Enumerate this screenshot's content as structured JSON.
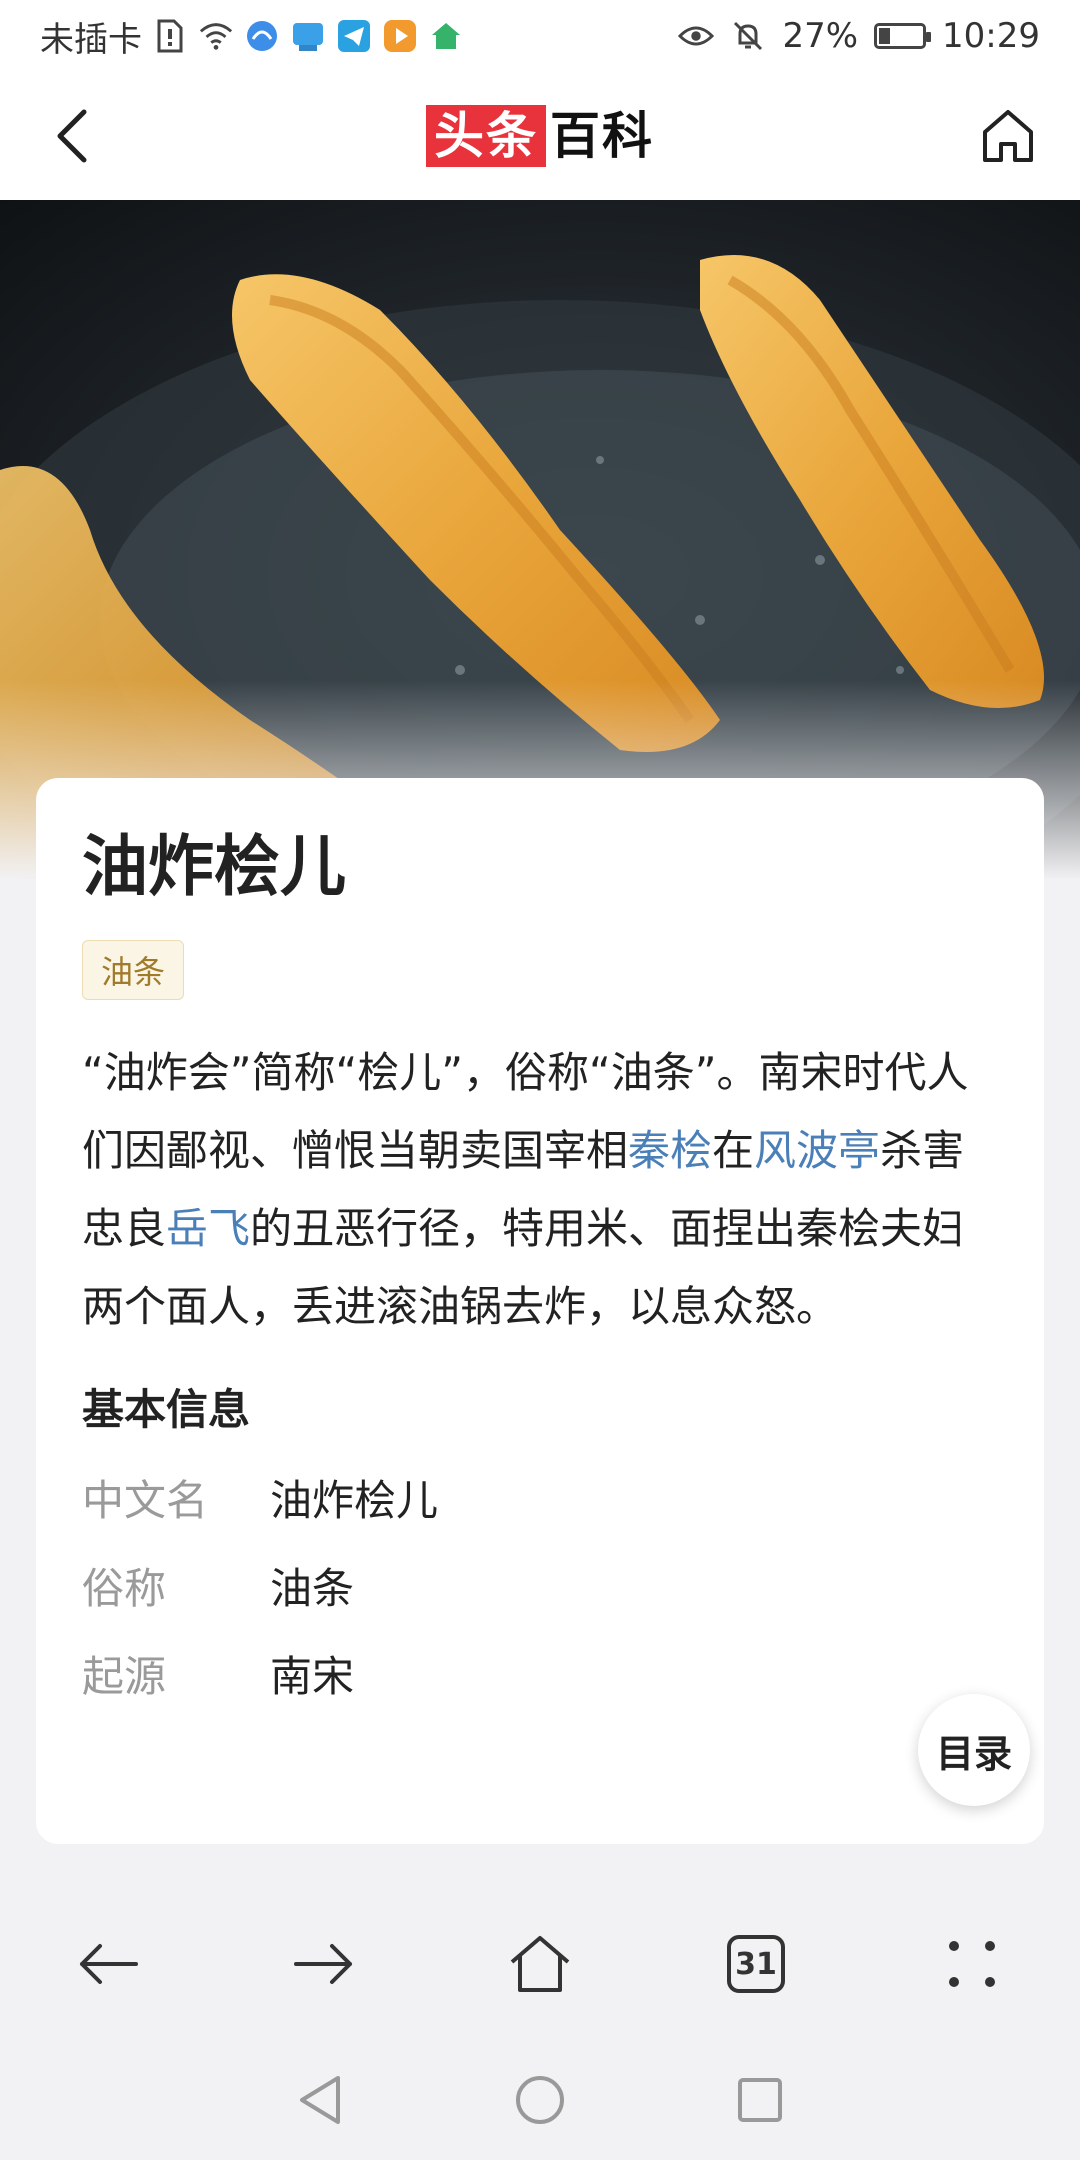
{
  "status_bar": {
    "carrier": "未插卡",
    "battery": "27%",
    "battery_level": 0.27,
    "time": "10:29"
  },
  "header": {
    "logo_red": "头条",
    "logo_black": "百科"
  },
  "article": {
    "title": "油炸桧儿",
    "alias_tag": "油条",
    "summary_parts": [
      {
        "text": "“油炸会”简称“桧儿”，俗称“油条”。南宋时代人们因鄙视、憎恨当朝卖国宰相",
        "link": false
      },
      {
        "text": "秦桧",
        "link": true
      },
      {
        "text": "在",
        "link": false
      },
      {
        "text": "风波亭",
        "link": true
      },
      {
        "text": "杀害忠良",
        "link": false
      },
      {
        "text": "岳飞",
        "link": true
      },
      {
        "text": "的丑恶行径，特用米、面捏出秦桧夫妇两个面人，丢进滚油锅去炸，以息众怒。",
        "link": false
      }
    ],
    "basic_info_title": "基本信息",
    "basic_info": [
      {
        "key": "中文名",
        "value": "油炸桧儿"
      },
      {
        "key": "俗称",
        "value": "油条"
      },
      {
        "key": "起源",
        "value": "南宋"
      }
    ],
    "toc_label": "目录"
  },
  "browser_toolbar": {
    "tab_count": "31"
  },
  "colors": {
    "brand_red": "#e8333c",
    "link_blue": "#4a7fb8",
    "tag_gold": "#a07b2b"
  }
}
